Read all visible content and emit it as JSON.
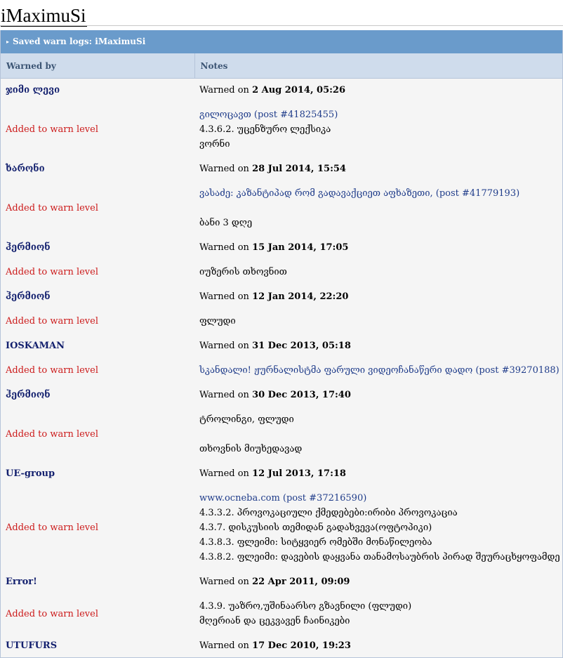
{
  "page": {
    "title": "iMaximuSi"
  },
  "panel": {
    "heading": "Saved warn logs: iMaximuSi"
  },
  "table": {
    "columns": [
      "Warned by",
      "Notes"
    ],
    "level_text": "Added to warn level",
    "warned_on_prefix": "Warned on",
    "entries": [
      {
        "by": "ჯიმი ლევი",
        "date": "2 Aug 2014, 05:26",
        "notes": [
          "გილოცავთ (post #41825455)",
          "4.3.6.2. უცენზურო ლექსიკა",
          "ვორნი"
        ]
      },
      {
        "by": "ხარონი",
        "date": "28 Jul 2014, 15:54",
        "notes": [
          "ვასაძე: კაზანტიპად რომ გადავაქციეთ აფხაზეთი, (post #41779193)",
          "",
          "ბანი 3 დღე"
        ]
      },
      {
        "by": "ჰერმიონ",
        "date": "15 Jan 2014, 17:05",
        "notes": [
          "იუზერის თხოვნით"
        ]
      },
      {
        "by": "ჰერმიონ",
        "date": "12 Jan 2014, 22:20",
        "notes": [
          "ფლუდი"
        ]
      },
      {
        "by": "IOSKAMAN",
        "date": "31 Dec 2013, 05:18",
        "notes": [
          "სკანდალი! ჟურნალისტმა ფარული ვიდეოჩანაწერი დადო (post #39270188)"
        ]
      },
      {
        "by": "ჰერმიონ",
        "date": "30 Dec 2013, 17:40",
        "notes": [
          "ტროლინგი, ფლუდი",
          "",
          "თხოვნის მიუხედავად"
        ]
      },
      {
        "by": "UE-group",
        "date": "12 Jul 2013, 17:18",
        "notes": [
          "www.ocneba.com (post #37216590)",
          "4.3.3.2. პროვოკაციული ქმედებები:ირიბი პროვოკაცია",
          "4.3.7. დისკუსიის თემიდან გადახვევა(ოფტოპიკი)",
          "4.3.8.3. ფლეიმი: სიტყვიერ ომებში მონაწილეობა",
          "4.3.8.2. ფლეიმი: დავების დაყვანა თანამოსაუბრის პირად შეურაცხყოფამდე"
        ]
      },
      {
        "by": "Error!",
        "date": "22 Apr 2011, 09:09",
        "notes": [
          "4.3.9. უაზრო,უშინაარსო გზავნილი (ფლუდი)",
          "მღერიან და ცეკვავენ ჩაინიკები"
        ]
      },
      {
        "by": "UTUFURS",
        "date": "17 Dec 2010, 19:23",
        "notes": []
      }
    ]
  }
}
